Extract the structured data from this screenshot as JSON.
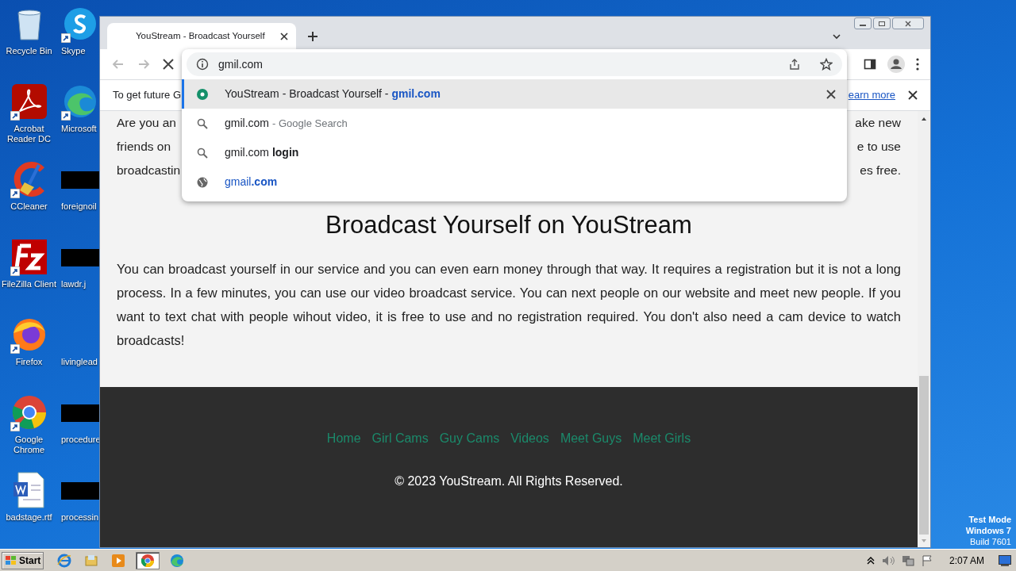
{
  "desktop": {
    "columns": [
      [
        {
          "kind": "recycle",
          "label": "Recycle Bin"
        },
        {
          "kind": "acrobat",
          "label": "Acrobat Reader DC"
        },
        {
          "kind": "ccleaner",
          "label": "CCleaner"
        },
        {
          "kind": "filezilla",
          "label": "FileZilla Client"
        },
        {
          "kind": "firefox",
          "label": "Firefox"
        },
        {
          "kind": "chrome",
          "label": "Google Chrome"
        },
        {
          "kind": "word",
          "label": "badstage.rtf"
        }
      ],
      [
        {
          "kind": "skype",
          "label": "Skype"
        },
        {
          "kind": "edge",
          "label": "Microsoft"
        },
        {
          "kind": "redacted",
          "label": "foreignoil"
        },
        {
          "kind": "redacted",
          "label": "lawdr.j"
        },
        {
          "kind": "blank",
          "label": "livinglead"
        },
        {
          "kind": "redacted",
          "label": "procedure"
        },
        {
          "kind": "redacted",
          "label": "processin"
        }
      ]
    ],
    "watermark_lines": [
      "Test Mode",
      "Windows 7",
      "Build 7601"
    ]
  },
  "browser": {
    "tab": {
      "title": "YouStream - Broadcast Yourself"
    },
    "address": {
      "value": "gmil.com"
    },
    "infobar": {
      "left": "To get future G",
      "link": "earn more"
    },
    "suggestions": [
      {
        "kind": "history",
        "selected": true,
        "text": "YouStream - Broadcast Yourself - **gmil.com**"
      },
      {
        "kind": "search",
        "selected": false,
        "text": "gmil.com",
        "hint": "- Google Search"
      },
      {
        "kind": "search",
        "selected": false,
        "text": "gmil.com **login**"
      },
      {
        "kind": "url",
        "selected": false,
        "text": "gmail**.com**"
      }
    ],
    "page": {
      "intro_lines": [
        {
          "left": "Are you an",
          "right": "ake new"
        },
        {
          "left": "friends on",
          "right": "e to use"
        },
        {
          "left": "broadcastin",
          "right": "es free."
        }
      ],
      "heading": "Broadcast Yourself on YouStream",
      "paragraph": "You can broadcast yourself in our service and you can even earn money through that way. It requires a registration but it is not a long process. In a few minutes, you can use our video broadcast service. You can next people on our website and meet new people. If you want to text chat with people wihout video, it is free to use and no registration required. You don't also need a cam device to watch broadcasts!",
      "footer_links": [
        "Home",
        "Girl Cams",
        "Guy Cams",
        "Videos",
        "Meet Guys",
        "Meet Girls"
      ],
      "copyright": "© 2023 YouStream. All Rights Reserved."
    }
  },
  "taskbar": {
    "start": "Start",
    "apps": [
      {
        "kind": "ie",
        "selected": false
      },
      {
        "kind": "explorer",
        "selected": false
      },
      {
        "kind": "media",
        "selected": false
      },
      {
        "kind": "chrome",
        "selected": true
      },
      {
        "kind": "edge",
        "selected": false
      }
    ],
    "clock": "2:07 AM"
  }
}
